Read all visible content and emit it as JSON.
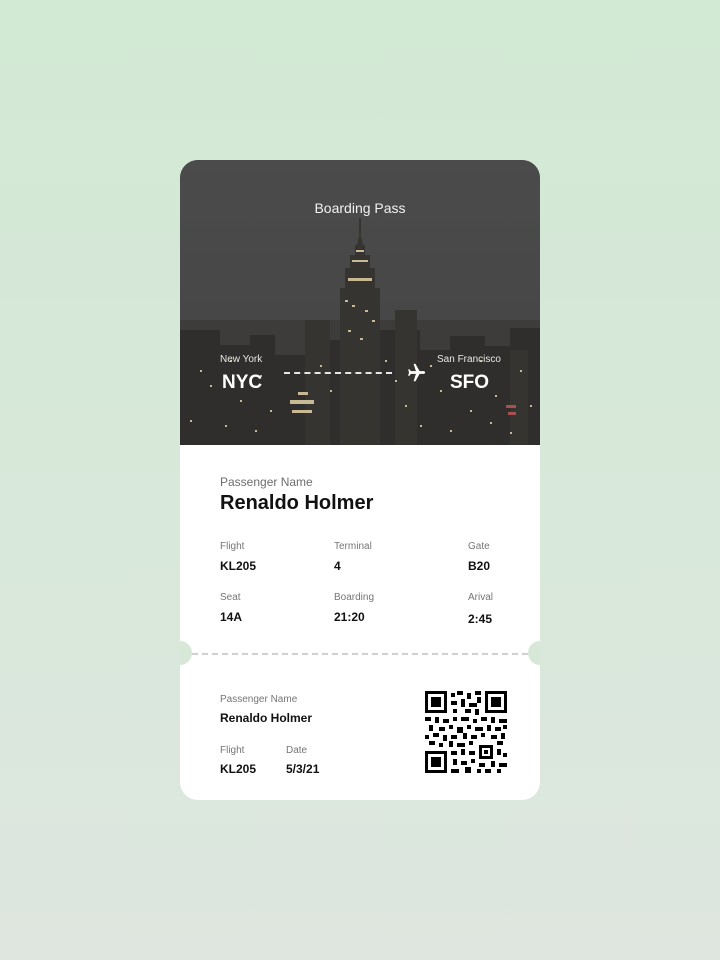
{
  "colors": {
    "background": "#d2e9d4",
    "hero_overlay": "#4a4a4a",
    "card": "#ffffff",
    "text_primary": "#111111",
    "text_muted": "#767676"
  },
  "pass": {
    "title": "Boarding Pass",
    "from": {
      "city": "New York",
      "code": "NYC"
    },
    "to": {
      "city": "San Francisco",
      "code": "SFO"
    },
    "passenger": {
      "label": "Passenger Name",
      "name": "Renaldo Holmer"
    },
    "details": {
      "flight": {
        "label": "Flight",
        "value": "KL205"
      },
      "terminal": {
        "label": "Terminal",
        "value": "4"
      },
      "gate": {
        "label": "Gate",
        "value": "B20"
      },
      "seat": {
        "label": "Seat",
        "value": "14A"
      },
      "boarding": {
        "label": "Boarding",
        "value": "21:20"
      },
      "arrival": {
        "label": "Arival",
        "value": "2:45"
      }
    }
  },
  "stub": {
    "passenger_label": "Passenger Name",
    "passenger_name": "Renaldo Holmer",
    "flight_label": "Flight",
    "flight_value": "KL205",
    "date_label": "Date",
    "date_value": "5/3/21"
  },
  "icons": {
    "plane": "airplane-icon",
    "qr": "qr-code"
  }
}
